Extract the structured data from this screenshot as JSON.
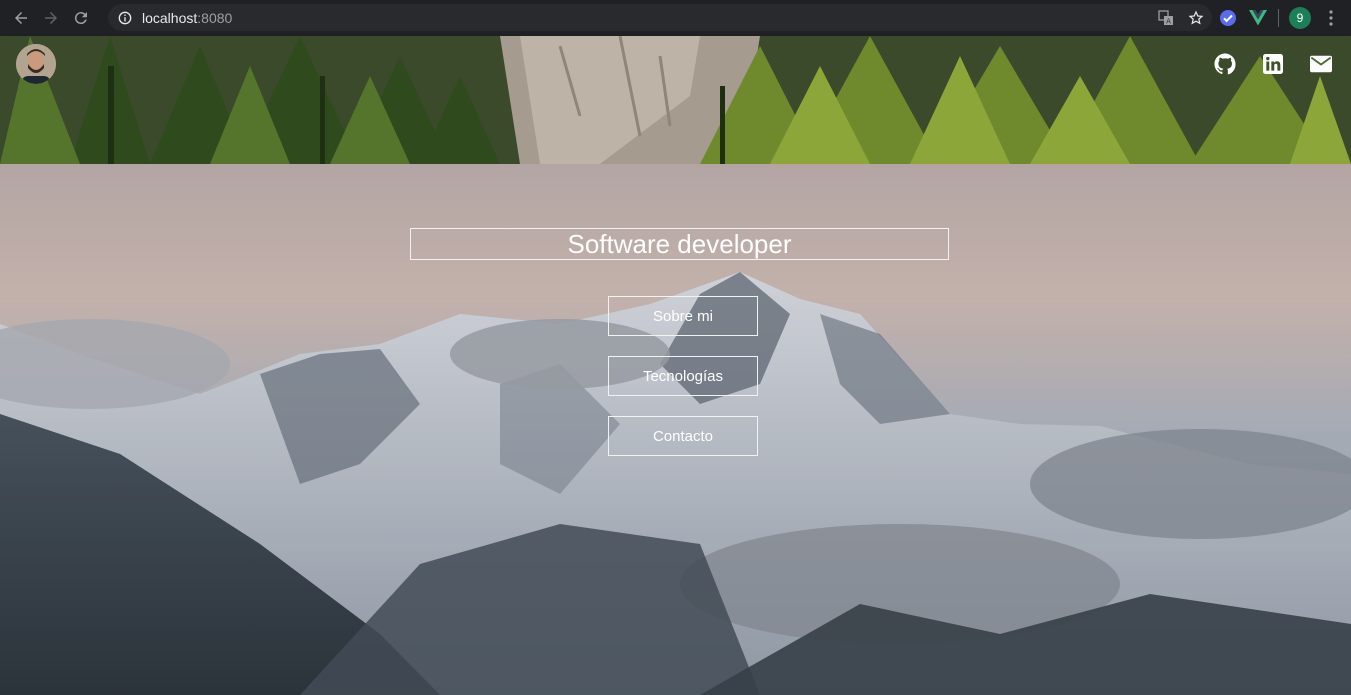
{
  "browser": {
    "url_host": "localhost",
    "url_port": ":8080",
    "profile_initial": "9"
  },
  "header": {
    "avatar_alt": "profile photo",
    "social": [
      {
        "icon": "github-icon"
      },
      {
        "icon": "linkedin-icon"
      },
      {
        "icon": "mail-icon"
      }
    ]
  },
  "hero": {
    "title": "Software developer",
    "buttons": [
      {
        "label": "Sobre mi"
      },
      {
        "label": "Tecnologías"
      },
      {
        "label": "Contacto"
      }
    ]
  },
  "colors": {
    "chrome_bg": "#202124",
    "omnibox_bg": "#292a2d",
    "button_border": "#f2f2f2",
    "text_white": "#ffffff"
  }
}
